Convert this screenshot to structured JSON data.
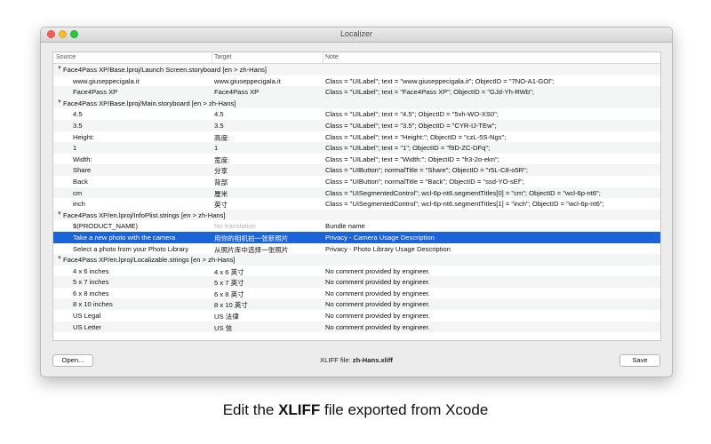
{
  "window": {
    "title": "Localizer"
  },
  "table": {
    "headers": [
      "Source",
      "Target",
      "Note"
    ],
    "groups": [
      {
        "label": "Face4Pass XP/Base.lproj/Launch Screen.storyboard  [en > zh-Hans]",
        "rows": [
          {
            "source": "www.giuseppecigala.it",
            "target": "www.giuseppecigala.it",
            "note": "Class = \"UILabel\"; text = \"www.giuseppecigala.it\"; ObjectID = \"7NO-A1-GOl\";"
          },
          {
            "source": "Face4Pass XP",
            "target": "Face4Pass XP",
            "note": "Class = \"UILabel\"; text = \"Face4Pass XP\"; ObjectID = \"GJd-Yh-RWb\";"
          }
        ]
      },
      {
        "label": "Face4Pass XP/Base.lproj/Main.storyboard  [en > zh-Hans]",
        "rows": [
          {
            "source": "4.5",
            "target": "4.5",
            "note": "Class = \"UILabel\"; text = \"4.5\"; ObjectID = \"5xh-WO-XS0\";"
          },
          {
            "source": "3.5",
            "target": "3.5",
            "note": "Class = \"UILabel\"; text = \"3.5\"; ObjectID = \"CYR-IJ-TEw\";"
          },
          {
            "source": "Height:",
            "target": "高度:",
            "note": "Class = \"UILabel\"; text = \"Height:\"; ObjectID = \"czL-5S-Ngs\";"
          },
          {
            "source": "1",
            "target": "1",
            "note": "Class = \"UILabel\"; text = \"1\"; ObjectID = \"f9D-ZC-DFq\";"
          },
          {
            "source": "Width:",
            "target": "宽度:",
            "note": "Class = \"UILabel\"; text = \"Width:\"; ObjectID = \"fr3-2o-ekn\";"
          },
          {
            "source": "Share",
            "target": "分享",
            "note": "Class = \"UIButton\"; normalTitle = \"Share\"; ObjectID = \"r5L-C8-o5R\";"
          },
          {
            "source": "Back",
            "target": "背部",
            "note": "Class = \"UIButton\"; normalTitle = \"Back\"; ObjectID = \"ssd-YO-sEf\";"
          },
          {
            "source": "cm",
            "target": "厘米",
            "note": "Class = \"UISegmentedControl\"; wcl-6p-nt6.segmentTitles[0] = \"cm\"; ObjectID = \"wcl-6p-nt6\";"
          },
          {
            "source": "inch",
            "target": "英寸",
            "note": "Class = \"UISegmentedControl\"; wcl-6p-nt6.segmentTitles[1] = \"inch\"; ObjectID = \"wcl-6p-nt6\";"
          }
        ]
      },
      {
        "label": "Face4Pass XP/en.lproj/InfoPlist.strings  [en > zh-Hans]",
        "rows": [
          {
            "source": "$(PRODUCT_NAME)",
            "target": "No translation",
            "note": "Bundle name"
          },
          {
            "source": "Take a new photo with the camera",
            "target": "用你的相机拍一张新照片",
            "note": "Privacy - Camera Usage Description"
          },
          {
            "source": "Select a photo from your Photo Library",
            "target": "从照片库中选择一张照片",
            "note": "Privacy - Photo Library Usage Description"
          }
        ]
      },
      {
        "label": "Face4Pass XP/en.lproj/Localizable.strings  [en > zh-Hans]",
        "rows": [
          {
            "source": "4 x 6 inches",
            "target": "4 x 6 英寸",
            "note": "No comment provided by engineer."
          },
          {
            "source": "5 x 7 inches",
            "target": "5 x 7 英寸",
            "note": "No comment provided by engineer."
          },
          {
            "source": "6 x 8 inches",
            "target": "6 x 8 英寸",
            "note": "No comment provided by engineer."
          },
          {
            "source": "8 x 10 inches",
            "target": "8 x 10 英寸",
            "note": "No comment provided by engineer."
          },
          {
            "source": "US Legal",
            "target": "US 法律",
            "note": "No comment provided by engineer."
          },
          {
            "source": "US Letter",
            "target": "US 信",
            "note": "No comment provided by engineer."
          }
        ]
      }
    ],
    "selected_row_source": "Take a new photo with the camera",
    "placeholder_target": "No translation"
  },
  "footer": {
    "open_label": "Open...",
    "status_prefix": "XLIFF file:",
    "status_file": "zh-Hans.xliff",
    "save_label": "Save"
  },
  "caption": {
    "prefix": "Edit the ",
    "bold": "XLIFF",
    "suffix": " file exported from Xcode"
  },
  "colors": {
    "selection": "#1a63d8",
    "close": "#fc5f57",
    "minimize": "#fdbc2e",
    "zoom": "#28c840"
  },
  "icons": {
    "group_toggle": "disclosure-triangle-down"
  }
}
